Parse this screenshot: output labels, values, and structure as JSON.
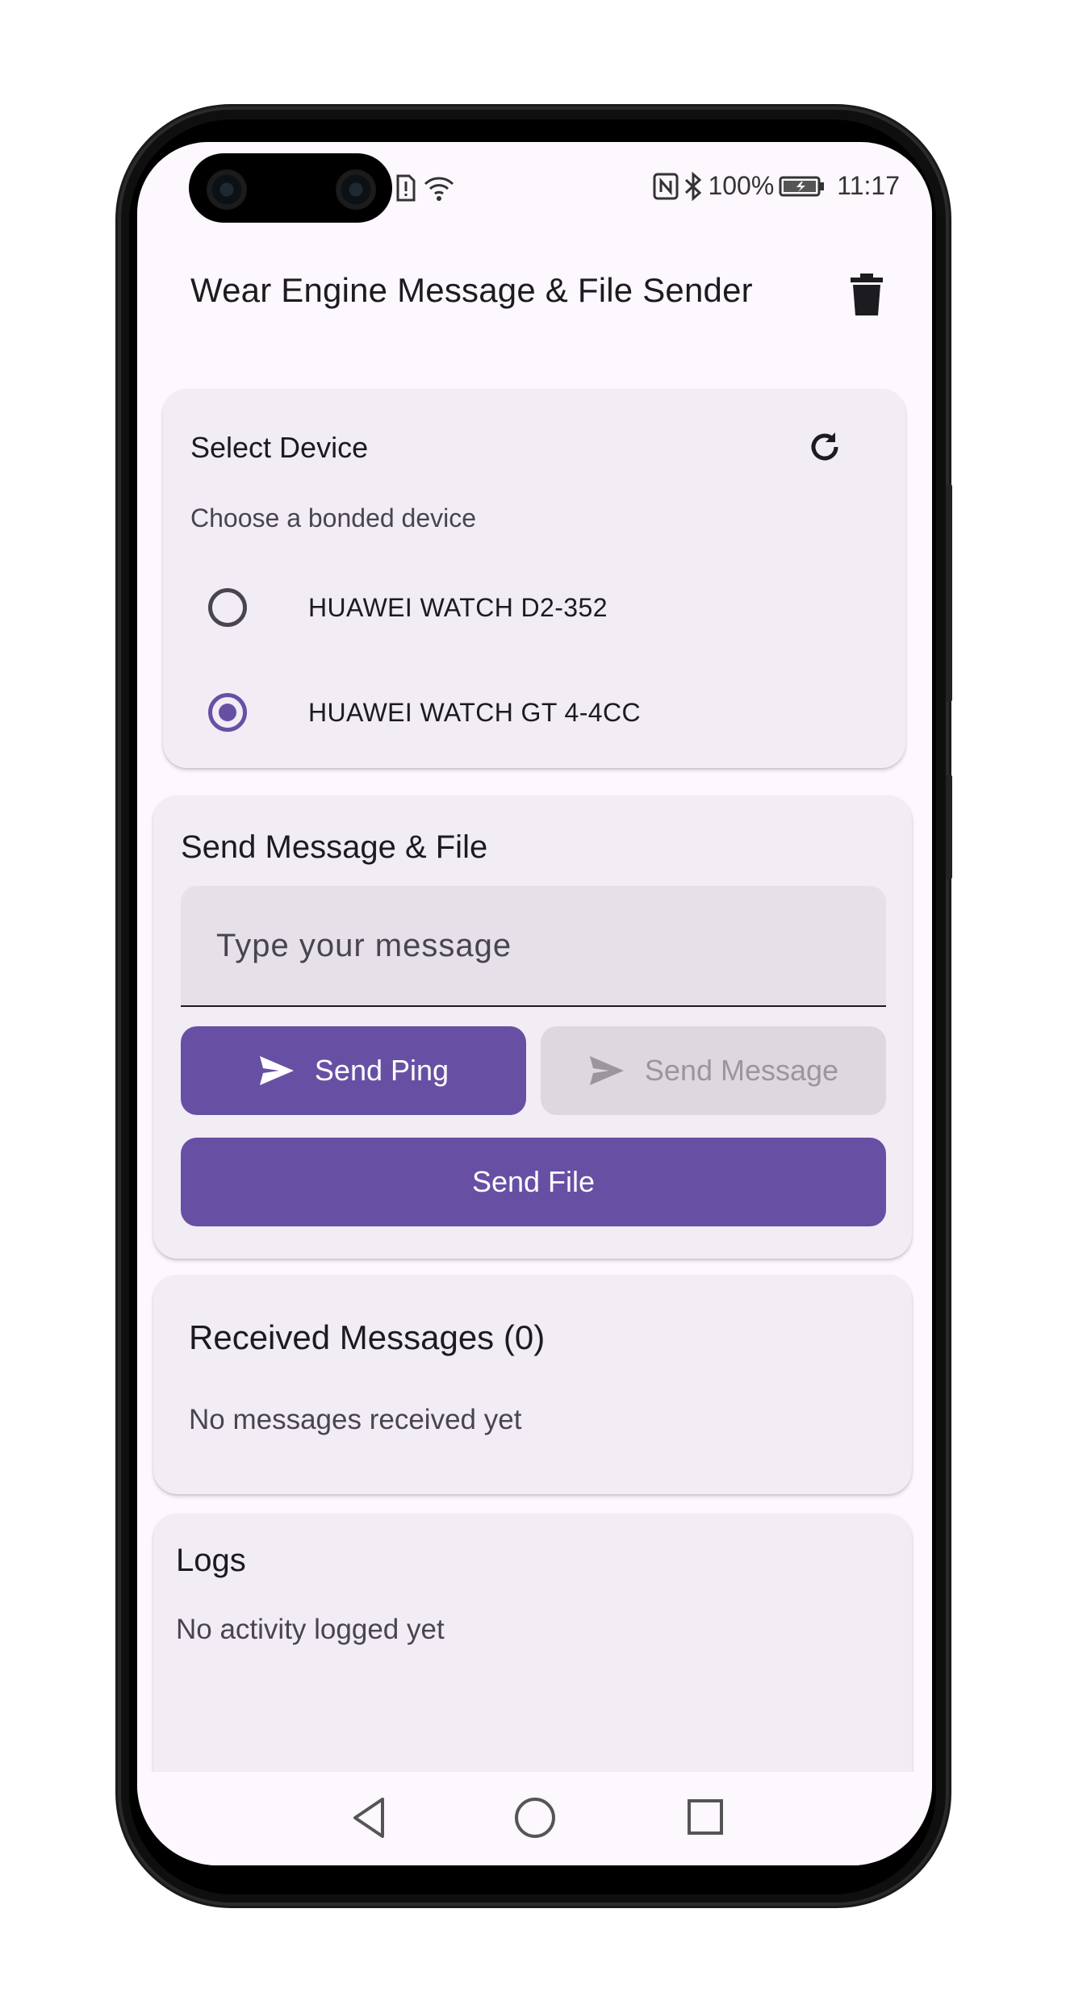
{
  "status_bar": {
    "battery": "100%",
    "time": "11:17"
  },
  "app_bar": {
    "title": "Wear Engine Message & File Sender",
    "delete_icon": "trash-icon"
  },
  "device_card": {
    "title": "Select Device",
    "subtitle": "Choose a bonded device",
    "refresh_icon": "refresh-icon",
    "devices": [
      {
        "name": "HUAWEI WATCH D2-352",
        "selected": false
      },
      {
        "name": "HUAWEI WATCH GT 4-4CC",
        "selected": true
      }
    ]
  },
  "send_card": {
    "title": "Send Message & File",
    "message_placeholder": "Type your message",
    "message_value": "",
    "send_ping_label": "Send Ping",
    "send_message_label": "Send Message",
    "send_file_label": "Send File"
  },
  "received_card": {
    "title": "Received Messages (0)",
    "empty_text": "No messages received yet"
  },
  "logs_card": {
    "title": "Logs",
    "empty_text": "No activity logged yet"
  },
  "colors": {
    "primary": "#6750a4",
    "background": "#fdf7fe",
    "card": "#f2ecf5"
  }
}
